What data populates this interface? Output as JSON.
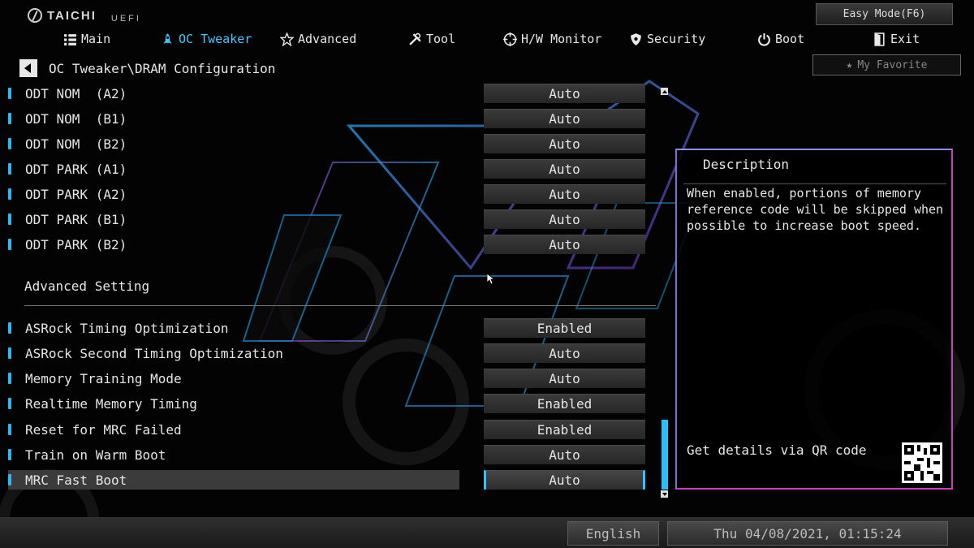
{
  "brand": {
    "name": "TAICHI",
    "sub": "UEFI"
  },
  "easy_mode": "Easy Mode(F6)",
  "nav": [
    {
      "label": "Main",
      "icon": "list-icon",
      "active": false
    },
    {
      "label": "OC Tweaker",
      "icon": "rocket-icon",
      "active": true
    },
    {
      "label": "Advanced",
      "icon": "star-icon",
      "active": false
    },
    {
      "label": "Tool",
      "icon": "tools-icon",
      "active": false
    },
    {
      "label": "H/W Monitor",
      "icon": "crosshair-icon",
      "active": false
    },
    {
      "label": "Security",
      "icon": "shield-icon",
      "active": false
    },
    {
      "label": "Boot",
      "icon": "power-icon",
      "active": false
    },
    {
      "label": "Exit",
      "icon": "exit-icon",
      "active": false
    }
  ],
  "breadcrumb": "OC Tweaker\\DRAM Configuration",
  "favorite": "My Favorite",
  "settings_top": [
    {
      "label": "ODT NOM  (A2)",
      "value": "Auto"
    },
    {
      "label": "ODT NOM  (B1)",
      "value": "Auto"
    },
    {
      "label": "ODT NOM  (B2)",
      "value": "Auto"
    },
    {
      "label": "ODT PARK (A1)",
      "value": "Auto"
    },
    {
      "label": "ODT PARK (A2)",
      "value": "Auto"
    },
    {
      "label": "ODT PARK (B1)",
      "value": "Auto"
    },
    {
      "label": "ODT PARK (B2)",
      "value": "Auto"
    }
  ],
  "section_title": "Advanced Setting",
  "settings_bottom": [
    {
      "label": "ASRock Timing Optimization",
      "value": "Enabled",
      "selected": false
    },
    {
      "label": "ASRock Second Timing Optimization",
      "value": "Auto",
      "selected": false
    },
    {
      "label": "Memory Training Mode",
      "value": "Auto",
      "selected": false
    },
    {
      "label": "Realtime Memory Timing",
      "value": "Enabled",
      "selected": false
    },
    {
      "label": "Reset for MRC Failed",
      "value": "Enabled",
      "selected": false
    },
    {
      "label": "Train on Warm Boot",
      "value": "Auto",
      "selected": false
    },
    {
      "label": "MRC Fast Boot",
      "value": "Auto",
      "selected": true
    }
  ],
  "description": {
    "title": "Description",
    "text": "When enabled, portions of memory reference code will be skipped when possible to increase boot speed.",
    "qr_label": "Get details via QR code"
  },
  "footer": {
    "language": "English",
    "datetime": "Thu 04/08/2021, 01:15:24"
  },
  "colors": {
    "accent": "#2fc4ff",
    "panel_border": "#c83fb9"
  }
}
